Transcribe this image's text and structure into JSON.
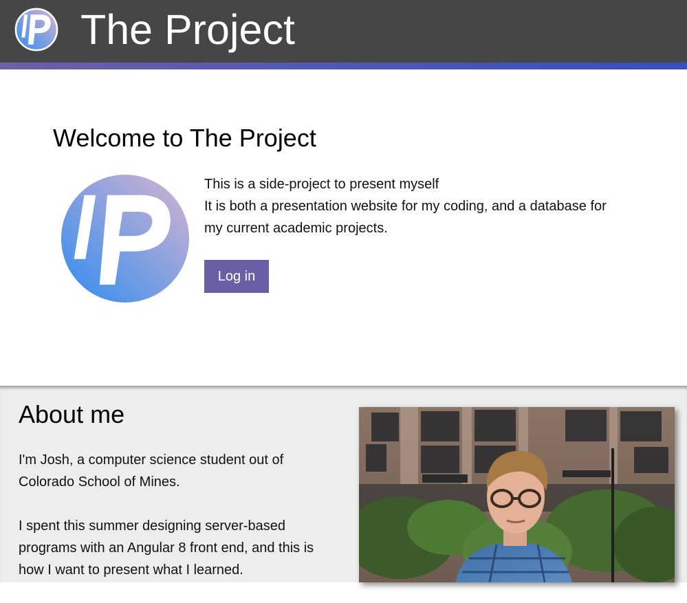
{
  "header": {
    "title": "The Project",
    "logo_icon": "project-p-logo-icon"
  },
  "welcome": {
    "title": "Welcome to The Project",
    "lines": [
      "This is a side-project to present myself",
      "It is both a presentation website for my coding, and a database for my current academic projects."
    ],
    "login_label": "Log in",
    "logo_icon": "project-p-logo-icon"
  },
  "about": {
    "title": "About me",
    "paragraphs": [
      "I'm Josh, a computer science student out of Colorado School of Mines.",
      "I spent this summer designing server-based programs with an Angular 8 front end, and this is how I want to present what I learned."
    ]
  },
  "colors": {
    "header_bg": "#464646",
    "accent_bar": "#4a56b8",
    "button_bg": "#6a5fa6",
    "about_bg": "#ededed"
  }
}
